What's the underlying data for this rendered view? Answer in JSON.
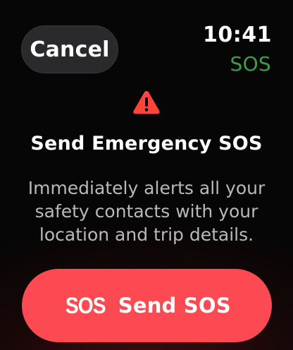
{
  "header": {
    "cancel_label": "Cancel",
    "time": "10:41",
    "status_label": "SOS"
  },
  "alert": {
    "icon": "warning-triangle-icon",
    "title": "Send Emergency SOS",
    "description": "Immediately alerts all your safety contacts with your location and trip details."
  },
  "action": {
    "glyph": "SOS",
    "label": "Send SOS"
  },
  "colors": {
    "accent_red": "#fd4a52",
    "status_green": "#3e9d4a",
    "cancel_bg": "#2a2a2c",
    "warning_red": "#ff453a"
  }
}
